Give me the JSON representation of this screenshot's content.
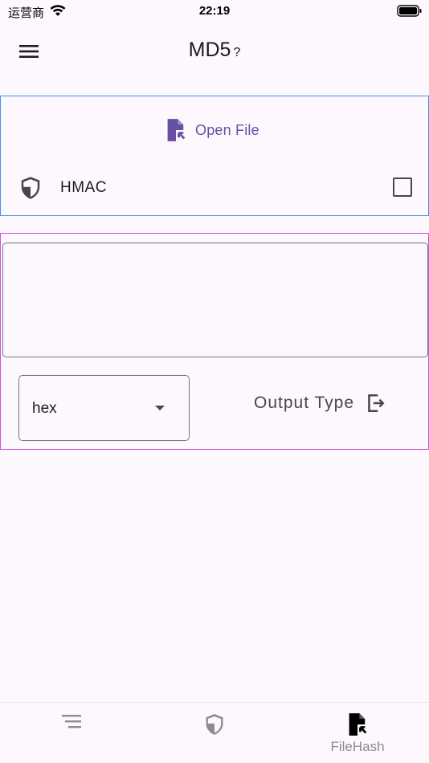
{
  "status_bar": {
    "carrier": "运营商",
    "time": "22:19"
  },
  "app_bar": {
    "title": "MD5",
    "help": "?"
  },
  "input_card": {
    "open_file_label": "Open File",
    "hmac_label": "HMAC",
    "hmac_checked": false
  },
  "output_card": {
    "output_value": "",
    "output_format": "hex",
    "output_type_label": "Output Type"
  },
  "bottom_nav": {
    "items": [
      {
        "icon": "list-icon",
        "label": ""
      },
      {
        "icon": "shield-icon",
        "label": ""
      },
      {
        "icon": "file-icon",
        "label": "FileHash",
        "active": true
      }
    ]
  },
  "colors": {
    "accent": "#6750a4",
    "background": "#fdf8fd",
    "card1_border": "#4a90e2",
    "card2_border": "#d050d8"
  }
}
